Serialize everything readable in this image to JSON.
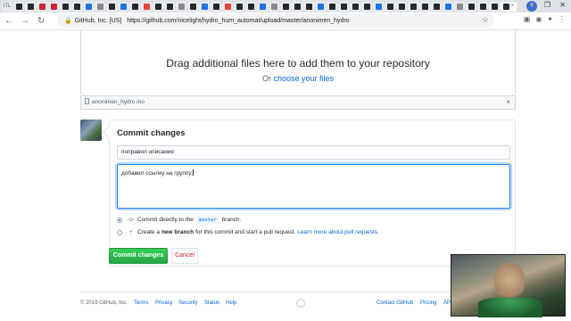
{
  "browser": {
    "tabs": [
      {
        "label": "ITL",
        "color": "#1a73e8"
      },
      {
        "label": "",
        "color": "#24292e"
      },
      {
        "label": "",
        "color": "#24292e"
      },
      {
        "label": "",
        "color": "#cb2431"
      },
      {
        "label": "",
        "color": "#cb2431"
      },
      {
        "label": "",
        "color": "#24292e"
      },
      {
        "label": "",
        "color": "#24292e"
      },
      {
        "label": "",
        "color": "#1a73e8"
      },
      {
        "label": "",
        "color": "#888888"
      },
      {
        "label": "",
        "color": "#24292e"
      },
      {
        "label": "",
        "color": "#1a73e8"
      },
      {
        "label": "",
        "color": "#24292e"
      },
      {
        "label": "",
        "color": "#ea4335"
      },
      {
        "label": "",
        "color": "#24292e"
      },
      {
        "label": "",
        "color": "#24292e"
      },
      {
        "label": "",
        "color": "#888888"
      },
      {
        "label": "",
        "color": "#24292e"
      },
      {
        "label": "",
        "color": "#1a73e8"
      },
      {
        "label": "",
        "color": "#24292e"
      },
      {
        "label": "",
        "color": "#ea4335"
      },
      {
        "label": "",
        "color": "#24292e"
      },
      {
        "label": "",
        "color": "#24292e"
      },
      {
        "label": "",
        "color": "#1a73e8"
      },
      {
        "label": "",
        "color": "#888888"
      },
      {
        "label": "",
        "color": "#24292e"
      },
      {
        "label": "",
        "color": "#24292e"
      },
      {
        "label": "",
        "color": "#24292e"
      },
      {
        "label": "",
        "color": "#1a73e8"
      },
      {
        "label": "",
        "color": "#24292e"
      },
      {
        "label": "",
        "color": "#24292e"
      },
      {
        "label": "",
        "color": "#24292e"
      },
      {
        "label": "",
        "color": "#24292e"
      },
      {
        "label": "",
        "color": "#1a73e8"
      },
      {
        "label": "",
        "color": "#24292e"
      },
      {
        "label": "",
        "color": "#24292e"
      },
      {
        "label": "",
        "color": "#24292e"
      },
      {
        "label": "",
        "color": "#24292e"
      },
      {
        "label": "",
        "color": "#24292e"
      },
      {
        "label": "",
        "color": "#1a73e8"
      },
      {
        "label": "",
        "color": "#888888"
      },
      {
        "label": "",
        "color": "#24292e"
      },
      {
        "label": "",
        "color": "#24292e"
      },
      {
        "label": "",
        "color": "#24292e"
      }
    ],
    "active_tab_close": "×",
    "new_tab": "+",
    "window_controls": "— ❐ ✕",
    "address_org": "GitHub, Inc. [US]",
    "address_url": "https://github.com/nicelight/hydro_hum_automat/upload/master/anonimen_hydro"
  },
  "upload": {
    "drop_title": "Drag additional files here to add them to your repository",
    "drop_or": "Or ",
    "choose_files": "choose your files",
    "file_name": "anonimen_hydro.ino",
    "remove_icon": "×"
  },
  "commit": {
    "title": "Commit changes",
    "summary_value": "поправил описание",
    "description_value": "добавил ссылку на группу.",
    "option_direct_prefix": "Commit directly to the",
    "branch": "master",
    "option_direct_suffix": "branch.",
    "option_new_prefix": "Create a",
    "option_new_bold": "new branch",
    "option_new_suffix": "for this commit and start a pull request.",
    "option_new_link": "Learn more about pull requests.",
    "commit_button": "Commit changes",
    "cancel_button": "Cancel"
  },
  "footer": {
    "copyright": "© 2019 GitHub, Inc.",
    "terms": "Terms",
    "privacy": "Privacy",
    "security": "Security",
    "status": "Status",
    "help": "Help",
    "contact": "Contact GitHub",
    "pricing": "Pricing",
    "api": "API"
  }
}
